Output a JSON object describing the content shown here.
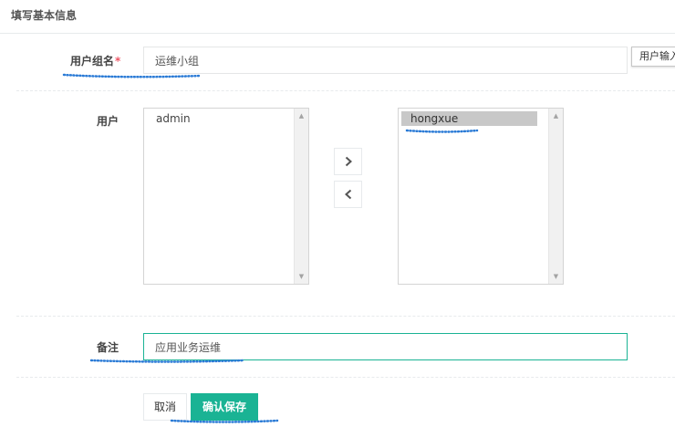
{
  "section": {
    "title": "填写基本信息"
  },
  "form": {
    "group_name": {
      "label": "用户组名",
      "required_mark": "*",
      "value": "运维小组",
      "tooltip": "用户输入"
    },
    "users": {
      "label": "用户",
      "available": [
        "admin"
      ],
      "selected": [
        "hongxue"
      ],
      "move_right_icon": "chevron-right-icon",
      "move_left_icon": "chevron-left-icon"
    },
    "remark": {
      "label": "备注",
      "value": "应用业务运维"
    }
  },
  "buttons": {
    "cancel": "取消",
    "save": "确认保存"
  },
  "colors": {
    "primary": "#1ab394",
    "required": "#ed5565",
    "annotation": "#2b7bd6"
  }
}
